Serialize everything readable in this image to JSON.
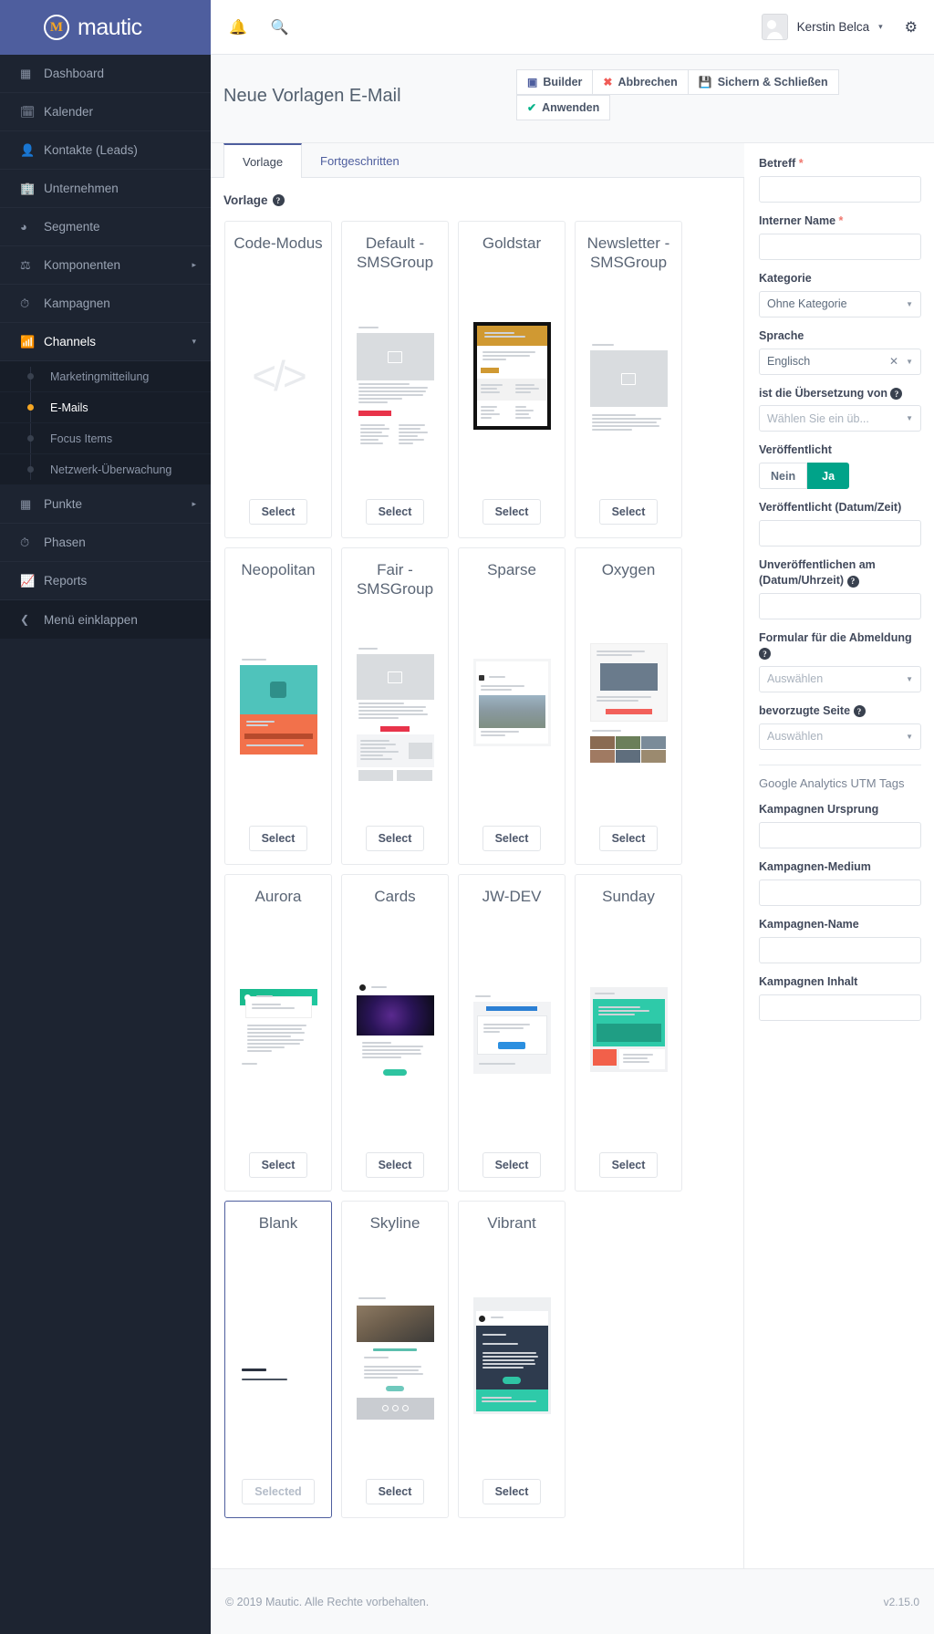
{
  "brand": {
    "name": "mautic",
    "mark": "M"
  },
  "sidebar": {
    "items": [
      {
        "label": "Dashboard",
        "icon": "grid-icon",
        "caret": ""
      },
      {
        "label": "Kalender",
        "icon": "calendar-icon",
        "caret": ""
      },
      {
        "label": "Kontakte (Leads)",
        "icon": "user-icon",
        "caret": ""
      },
      {
        "label": "Unternehmen",
        "icon": "building-icon",
        "caret": ""
      },
      {
        "label": "Segmente",
        "icon": "pie-chart-icon",
        "caret": ""
      },
      {
        "label": "Komponenten",
        "icon": "puzzle-icon",
        "caret": "▸"
      },
      {
        "label": "Kampagnen",
        "icon": "clock-icon",
        "caret": ""
      },
      {
        "label": "Channels",
        "icon": "rss-icon",
        "caret": "▾"
      }
    ],
    "sub_items": [
      {
        "label": "Marketingmitteilung"
      },
      {
        "label": "E-Mails"
      },
      {
        "label": "Focus Items"
      },
      {
        "label": "Netzwerk-Überwachung"
      }
    ],
    "items_after": [
      {
        "label": "Punkte",
        "icon": "table-icon",
        "caret": "▸"
      },
      {
        "label": "Phasen",
        "icon": "gauge-icon",
        "caret": ""
      },
      {
        "label": "Reports",
        "icon": "chart-icon",
        "caret": ""
      }
    ],
    "collapse": {
      "label": "Menü einklappen",
      "icon": "chevron-left-icon"
    }
  },
  "topbar": {
    "notifications_icon": "bell-icon",
    "search_icon": "search-icon",
    "user_name": "Kerstin Belca",
    "caret": "▾",
    "settings_icon": "gear-icon"
  },
  "header": {
    "title": "Neue Vorlagen E-Mail",
    "buttons": [
      {
        "label": "Builder",
        "icon": "cube-icon"
      },
      {
        "label": "Abbrechen",
        "icon": "x-icon"
      },
      {
        "label": "Sichern & Schließen",
        "icon": "floppy-icon"
      }
    ],
    "buttons_row2": [
      {
        "label": "Anwenden",
        "icon": "check-icon"
      }
    ]
  },
  "tabs": [
    {
      "label": "Vorlage",
      "active": true
    },
    {
      "label": "Fortgeschritten",
      "active": false
    }
  ],
  "main": {
    "section_label": "Vorlage",
    "select_label": "Select",
    "selected_label": "Selected",
    "templates": [
      {
        "name": "Code-Modus",
        "thumb": "code",
        "selected": false
      },
      {
        "name": "Default - SMSGroup",
        "thumb": "default",
        "selected": false
      },
      {
        "name": "Goldstar",
        "thumb": "goldstar",
        "selected": false
      },
      {
        "name": "Newsletter - SMSGroup",
        "thumb": "newsletter",
        "selected": false
      },
      {
        "name": "Neopolitan",
        "thumb": "neopolitan",
        "selected": false
      },
      {
        "name": "Fair - SMSGroup",
        "thumb": "fair",
        "selected": false
      },
      {
        "name": "Sparse",
        "thumb": "sparse",
        "selected": false
      },
      {
        "name": "Oxygen",
        "thumb": "oxygen",
        "selected": false
      },
      {
        "name": "Aurora",
        "thumb": "aurora",
        "selected": false
      },
      {
        "name": "Cards",
        "thumb": "cards",
        "selected": false
      },
      {
        "name": "JW-DEV",
        "thumb": "jwdev",
        "selected": false
      },
      {
        "name": "Sunday",
        "thumb": "sunday",
        "selected": false
      },
      {
        "name": "Blank",
        "thumb": "blank",
        "selected": true
      },
      {
        "name": "Skyline",
        "thumb": "skyline",
        "selected": false
      },
      {
        "name": "Vibrant",
        "thumb": "vibrant",
        "selected": false
      }
    ]
  },
  "form": {
    "subject": {
      "label": "Betreff",
      "required": true,
      "value": ""
    },
    "internal_name": {
      "label": "Interner Name",
      "required": true,
      "value": ""
    },
    "category": {
      "label": "Kategorie",
      "value": "Ohne Kategorie"
    },
    "language": {
      "label": "Sprache",
      "value": "Englisch",
      "clearable": true
    },
    "translation_of": {
      "label": "ist die Übersetzung von",
      "value": "Wählen Sie ein üb...",
      "help": true
    },
    "published": {
      "label": "Veröffentlicht",
      "no": "Nein",
      "yes": "Ja",
      "selected": "Ja"
    },
    "publish_at": {
      "label": "Veröffentlicht (Datum/Zeit)",
      "value": ""
    },
    "unpublish_at": {
      "label": "Unveröffentlichen am (Datum/Uhrzeit)",
      "value": "",
      "help": true
    },
    "unsubscribe_form": {
      "label": "Formular für die Abmeldung",
      "placeholder": "Auswählen",
      "help": true
    },
    "preferred_page": {
      "label": "bevorzugte Seite",
      "placeholder": "Auswählen",
      "help": true
    },
    "utm_group_title": "Google Analytics UTM Tags",
    "utm_source": {
      "label": "Kampagnen Ursprung",
      "value": ""
    },
    "utm_medium": {
      "label": "Kampagnen-Medium",
      "value": ""
    },
    "utm_name": {
      "label": "Kampagnen-Name",
      "value": ""
    },
    "utm_content": {
      "label": "Kampagnen Inhalt",
      "value": ""
    }
  },
  "footer": {
    "copyright": "© 2019 Mautic. Alle Rechte vorbehalten.",
    "version": "v2.15.0"
  },
  "colors": {
    "brand_purple": "#4e5e9e",
    "sidebar_dark": "#1d2431",
    "accent_orange": "#f5a623",
    "success_green": "#00a389",
    "danger_red": "#f05c57"
  }
}
